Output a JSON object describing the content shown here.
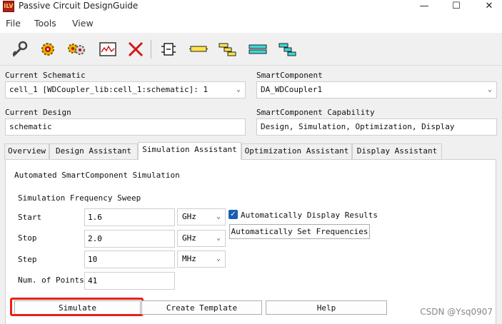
{
  "window": {
    "app_icon_text": "ILV",
    "title": "Passive Circuit DesignGuide",
    "controls": {
      "minimize": "—",
      "maximize": "☐",
      "close": "✕"
    }
  },
  "menu": [
    "File",
    "Tools",
    "View"
  ],
  "toolbar": {
    "icons": [
      "wrench-icon",
      "gear-icon",
      "gears-icon",
      "graph-icon",
      "delete-icon",
      "component-icon",
      "line-icon",
      "stepped-line-icon",
      "coupled-line-icon",
      "multi-line-icon"
    ]
  },
  "schematic": {
    "label": "Current Schematic",
    "value": "cell_1 [WDCoupler_lib:cell_1:schematic]: 1"
  },
  "smartcomponent": {
    "label": "SmartComponent",
    "value": "DA_WDCoupler1"
  },
  "design": {
    "label": "Current Design",
    "value": "schematic"
  },
  "capability": {
    "label": "SmartComponent Capability",
    "value": "Design, Simulation, Optimization, Display"
  },
  "tabs": [
    "Overview",
    "Design Assistant",
    "Simulation Assistant",
    "Optimization Assistant",
    "Display Assistant"
  ],
  "active_tab": "Simulation Assistant",
  "simulation": {
    "heading": "Automated SmartComponent Simulation",
    "sweep_heading": "Simulation Frequency Sweep",
    "start": {
      "label": "Start",
      "value": "1.6",
      "unit": "GHz"
    },
    "stop": {
      "label": "Stop",
      "value": "2.0",
      "unit": "GHz"
    },
    "step": {
      "label": "Step",
      "value": "10",
      "unit": "MHz"
    },
    "points": {
      "label": "Num. of Points",
      "value": "41"
    },
    "auto_display": {
      "label": "Automatically Display Results",
      "checked": true
    },
    "auto_set_button": "Automatically Set Frequencies",
    "simulate_button": "Simulate",
    "template_button": "Create Template",
    "help_button": "Help"
  },
  "watermark": "CSDN @Ysq0907",
  "colors": {
    "highlight": "#e8201a",
    "checkbox": "#1a5fb4"
  }
}
